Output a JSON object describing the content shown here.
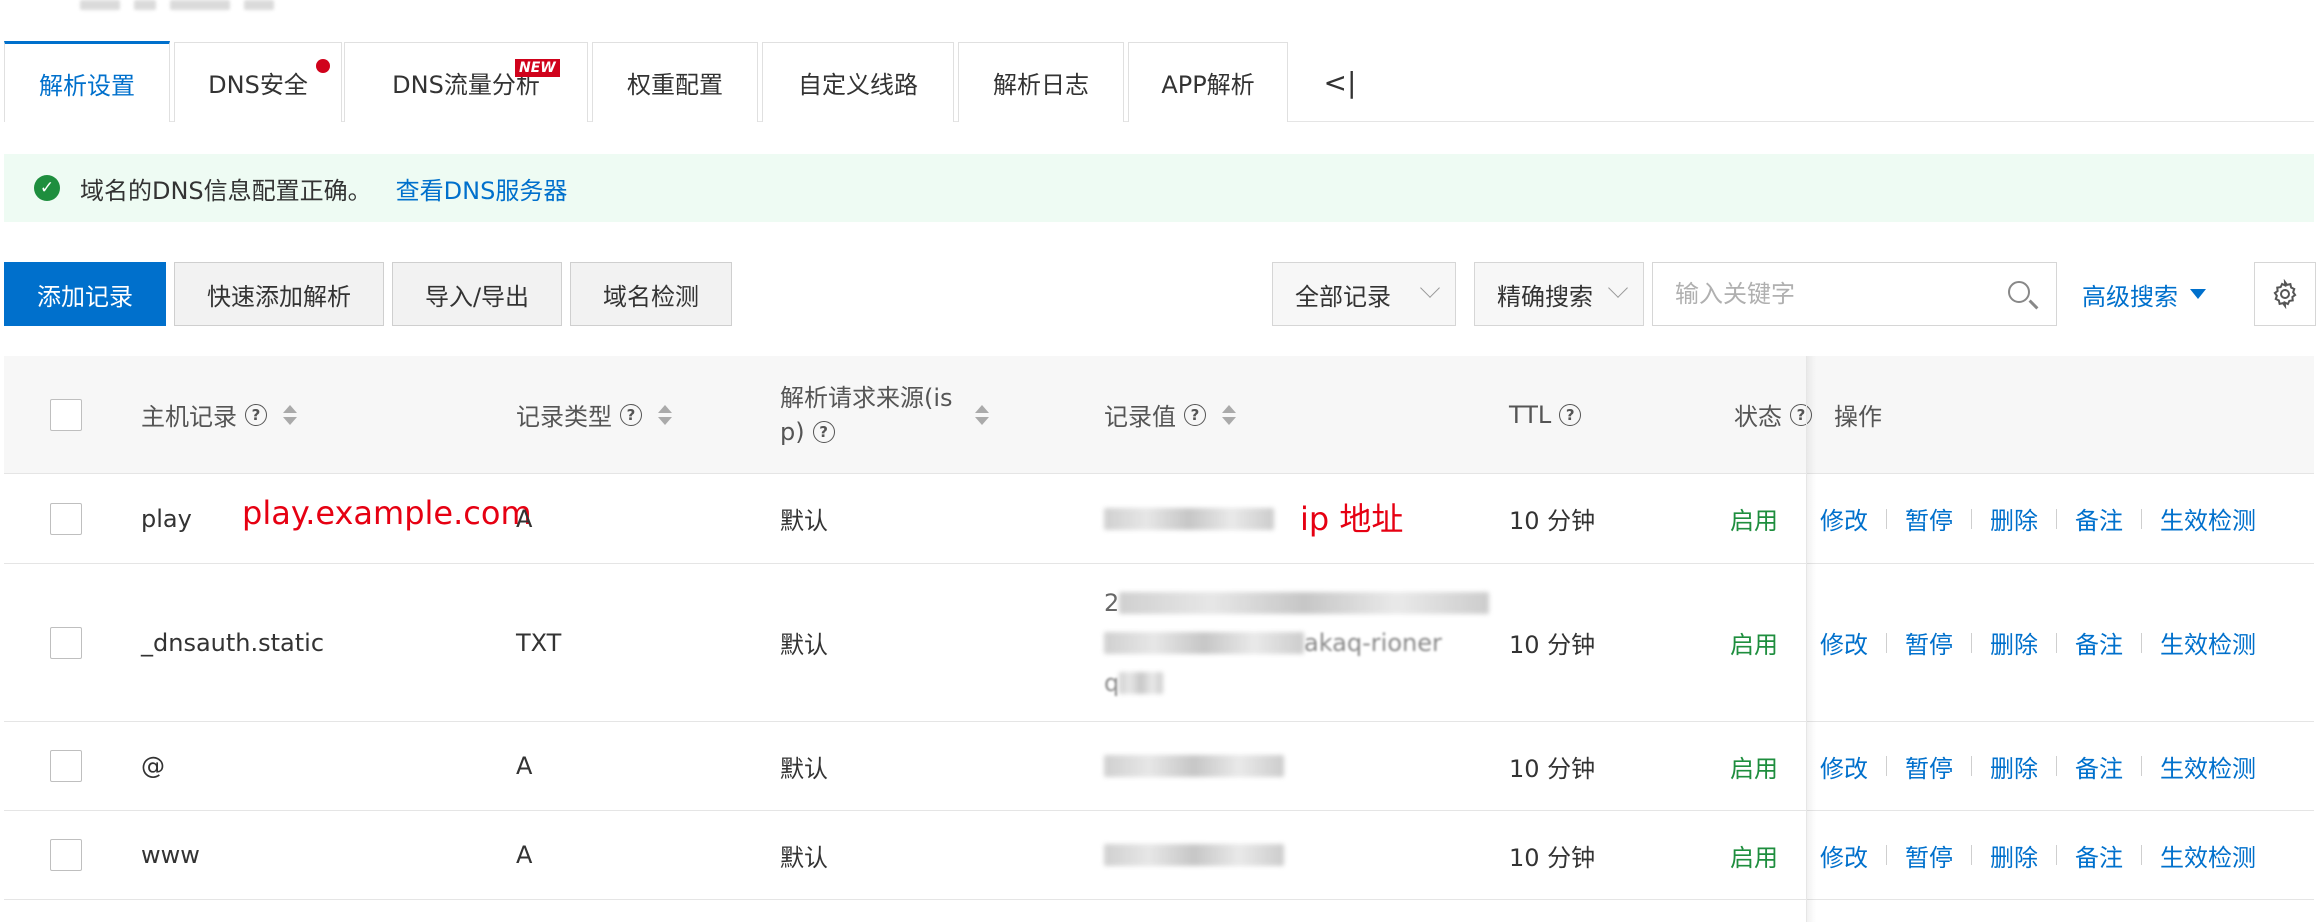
{
  "tabs": [
    {
      "label": "解析设置",
      "active": true
    },
    {
      "label": "DNS安全",
      "has_dot": true
    },
    {
      "label": "DNS流量分析",
      "badge": "NEW"
    },
    {
      "label": "权重配置"
    },
    {
      "label": "自定义线路"
    },
    {
      "label": "解析日志"
    },
    {
      "label": "APP解析"
    }
  ],
  "tabs_collapse_icon": "collapse-left-icon",
  "tabs_collapse_glyph": "<|",
  "alert": {
    "message": "域名的DNS信息配置正确。",
    "link": "查看DNS服务器",
    "icon": "check-circle-icon",
    "icon_glyph": "✓"
  },
  "toolbar": {
    "add_record": "添加记录",
    "quick_add": "快速添加解析",
    "import_export": "导入/导出",
    "domain_check": "域名检测",
    "filter_all": "全部记录",
    "search_mode": "精确搜索",
    "search_placeholder": "输入关键字",
    "advanced_search": "高级搜索"
  },
  "table": {
    "headers": {
      "host": "主机记录",
      "type": "记录类型",
      "source": "解析请求来源(isp)",
      "source_line1": "解析请求来源(is",
      "source_line2": "p)",
      "value": "记录值",
      "ttl": "TTL",
      "status": "状态",
      "ops": "操作"
    },
    "help_glyph": "?",
    "rows": [
      {
        "host": "play",
        "type": "A",
        "source": "默认",
        "ttl": "10 分钟",
        "status": "启用"
      },
      {
        "host": "_dnsauth.static",
        "type": "TXT",
        "source": "默认",
        "value_prefix": "2",
        "value_line2_suffix": "akaq-rioner",
        "value_line3": "q",
        "ttl": "10 分钟",
        "status": "启用"
      },
      {
        "host": "@",
        "type": "A",
        "source": "默认",
        "ttl": "10 分钟",
        "status": "启用"
      },
      {
        "host": "www",
        "type": "A",
        "source": "默认",
        "ttl": "10 分钟",
        "status": "启用"
      }
    ],
    "row_actions": [
      "修改",
      "暂停",
      "删除",
      "备注",
      "生效检测"
    ]
  },
  "annotations": {
    "host_example": "play.example.com",
    "ip_label": "ip 地址"
  },
  "colors": {
    "primary": "#0070cc",
    "success": "#1e8e3e",
    "badge_red": "#d0021b",
    "annotation_red": "#e60012",
    "alert_bg": "#eefbf3"
  }
}
